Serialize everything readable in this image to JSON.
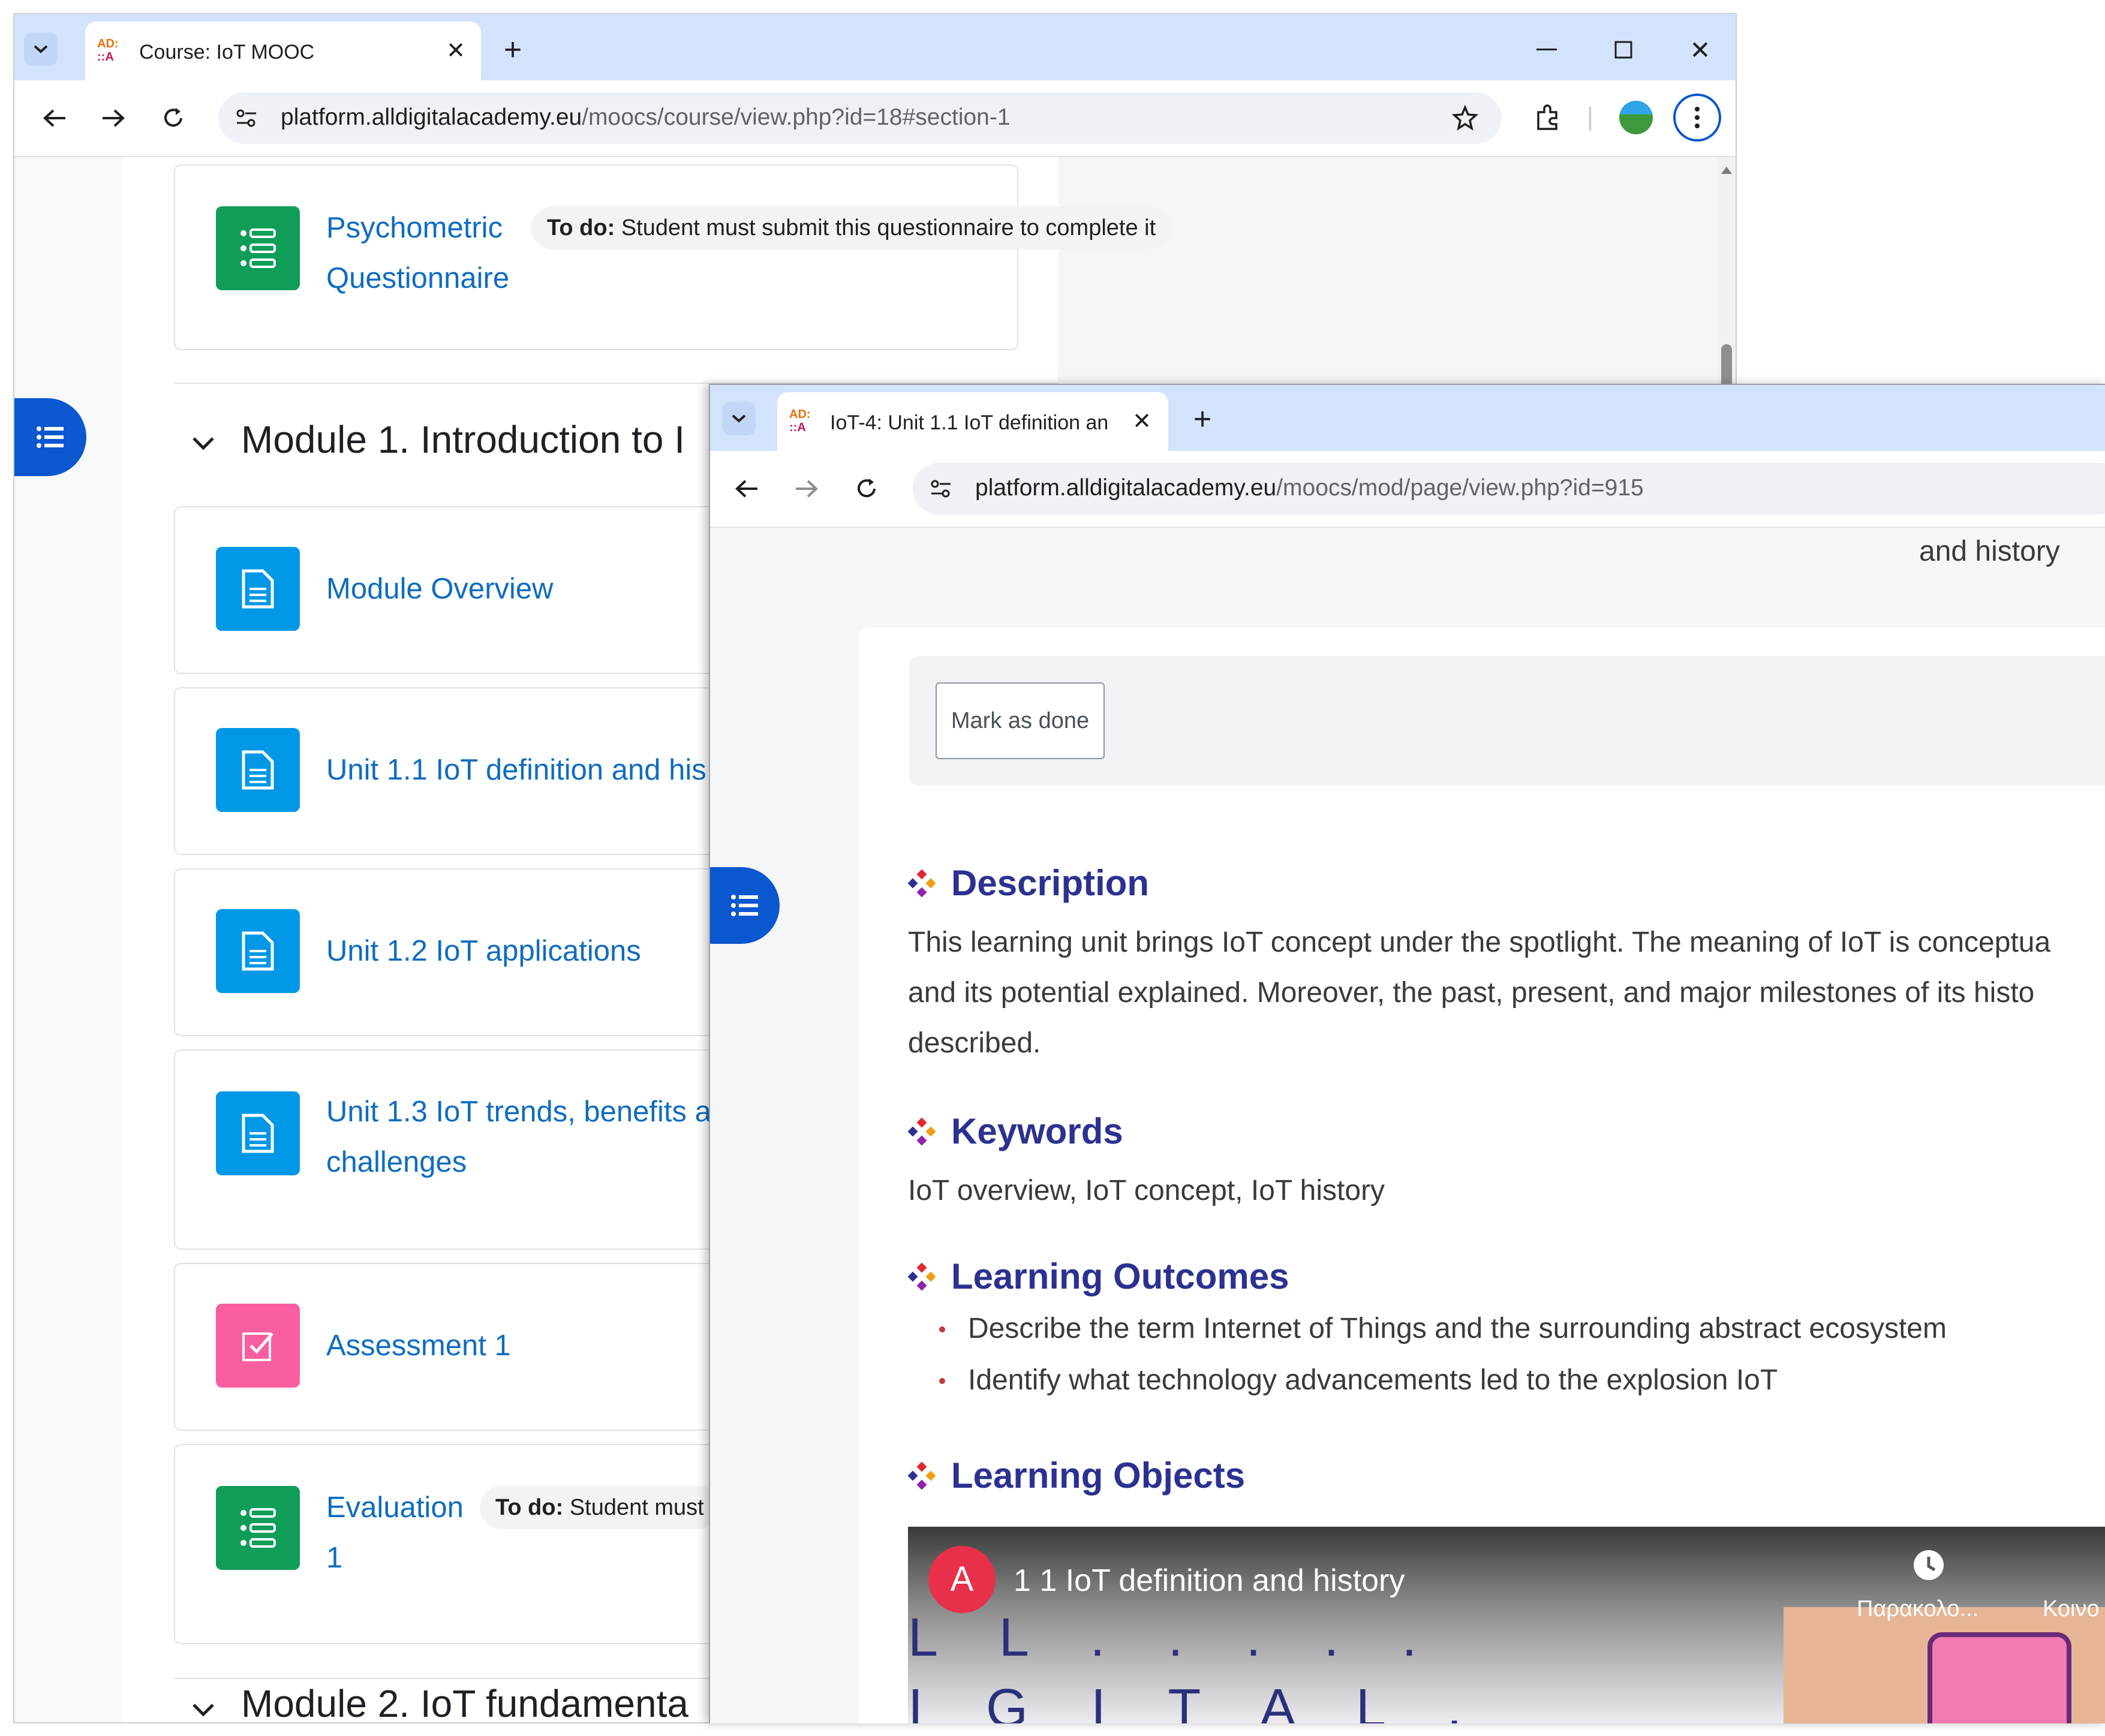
{
  "window_back": {
    "tab_title": "Course: IoT MOOC",
    "favicon": "ADA-logo",
    "url_host": "platform.alldigitalacademy.eu",
    "url_path": "/moocs/course/view.php?id=18#section-1",
    "psychometric": {
      "title_line1": "Psychometric",
      "title_line2": "Questionnaire",
      "todo_label": "To do:",
      "todo_text": "Student must submit this questionnaire to complete it"
    },
    "module1_title": "Module 1. Introduction to I",
    "activities": [
      {
        "line1": "Module Overview",
        "line2": "",
        "type": "page"
      },
      {
        "line1": "Unit 1.1 IoT definition and his",
        "line2": "",
        "type": "page"
      },
      {
        "line1": "Unit 1.2 IoT applications",
        "line2": "",
        "type": "page"
      },
      {
        "line1": "Unit 1.3 IoT trends, benefits a",
        "line2": "challenges",
        "type": "page"
      },
      {
        "line1": "Assessment 1",
        "line2": "",
        "type": "assessment"
      },
      {
        "line1": "Evaluation",
        "line2": "1",
        "type": "questionnaire"
      }
    ],
    "evaluation_todo_label": "To do:",
    "evaluation_todo_text": "Student must",
    "module2_title": "Module 2. IoT fundamenta"
  },
  "window_front": {
    "tab_title": "IoT-4: Unit 1.1 IoT definition an",
    "url_host": "platform.alldigitalacademy.eu",
    "url_path": "/moocs/mod/page/view.php?id=915",
    "breadcrumb_tail": "and history",
    "mark_done_label": "Mark as done",
    "description_title": "Description",
    "description_lines": [
      "This learning unit brings IoT concept under the spotlight. The meaning of IoT is conceptua",
      "and its potential explained. Moreover, the past, present, and major milestones of its histo",
      "described."
    ],
    "keywords_title": "Keywords",
    "keywords_text": "IoT overview, IoT concept, IoT history",
    "outcomes_title": "Learning Outcomes",
    "outcomes": [
      "Describe the term Internet of Things and the surrounding abstract ecosystem",
      "Identify what technology advancements led to the explosion IoT"
    ],
    "objects_title": "Learning Objects",
    "video": {
      "avatar_letter": "A",
      "title": "1 1 IoT definition and history",
      "watch_later": "Παρακολο...",
      "share": "Κοινο",
      "frame_text_line1": "L L . . . . .",
      "frame_text_line2": "I G I T A L ."
    }
  },
  "colors": {
    "link": "#0f6cbf",
    "questionnaire_green": "#0f9d58",
    "page_blue": "#0098e6",
    "assessment_pink": "#f95ea0",
    "heading_navy": "#2c3191",
    "drawer_blue": "#0b57d0",
    "tabbar": "#d3e3fd"
  }
}
